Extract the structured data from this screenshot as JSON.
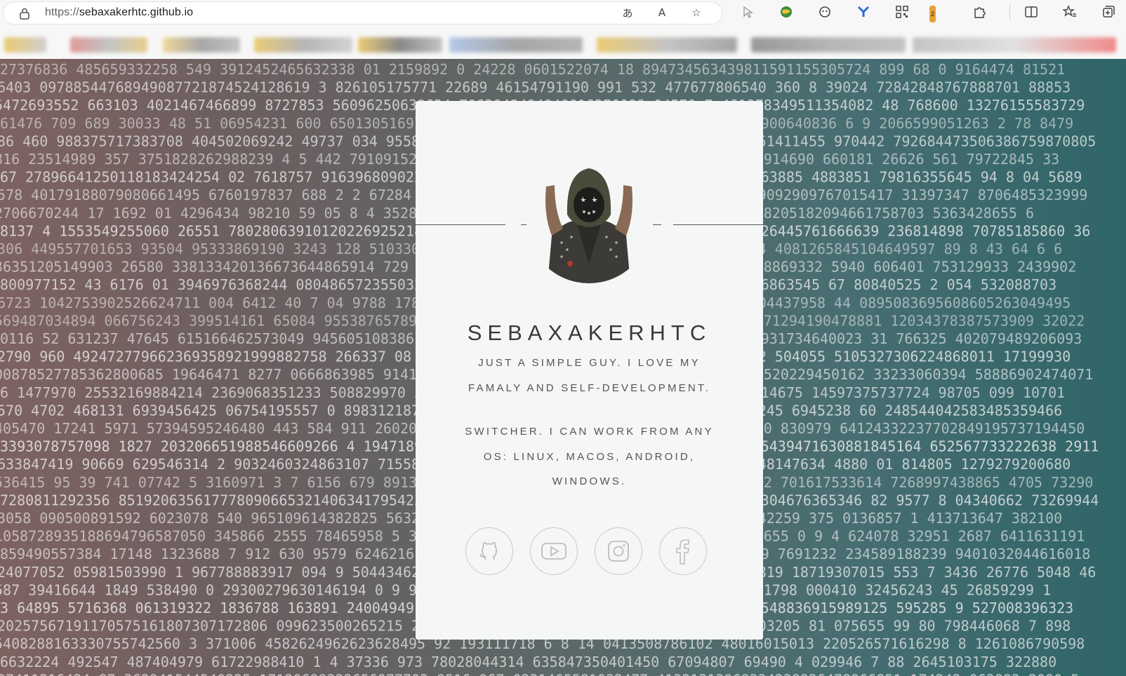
{
  "browser": {
    "url_protocol": "https://",
    "url_host": "sebaxakerhtc.github.io",
    "badge_count": "2"
  },
  "profile": {
    "name": "SEBAXAKERHTC",
    "bio_line_1": "JUST A SIMPLE GUY. I LOVE MY",
    "bio_line_2": "FAMALY AND SELF-DEVELOPMENT.",
    "bio_line_3": "SWITCHER. I CAN WORK FROM ANY",
    "bio_line_4": "OS: LINUX, MACOS, ANDROID,",
    "bio_line_5": "WINDOWS."
  },
  "social": [
    {
      "name": "github-icon"
    },
    {
      "name": "youtube-icon"
    },
    {
      "name": "instagram-icon"
    },
    {
      "name": "facebook-icon"
    }
  ],
  "colors": {
    "card": "#f5f6f6",
    "digits": "#e8e8e8",
    "text": "#555555"
  }
}
